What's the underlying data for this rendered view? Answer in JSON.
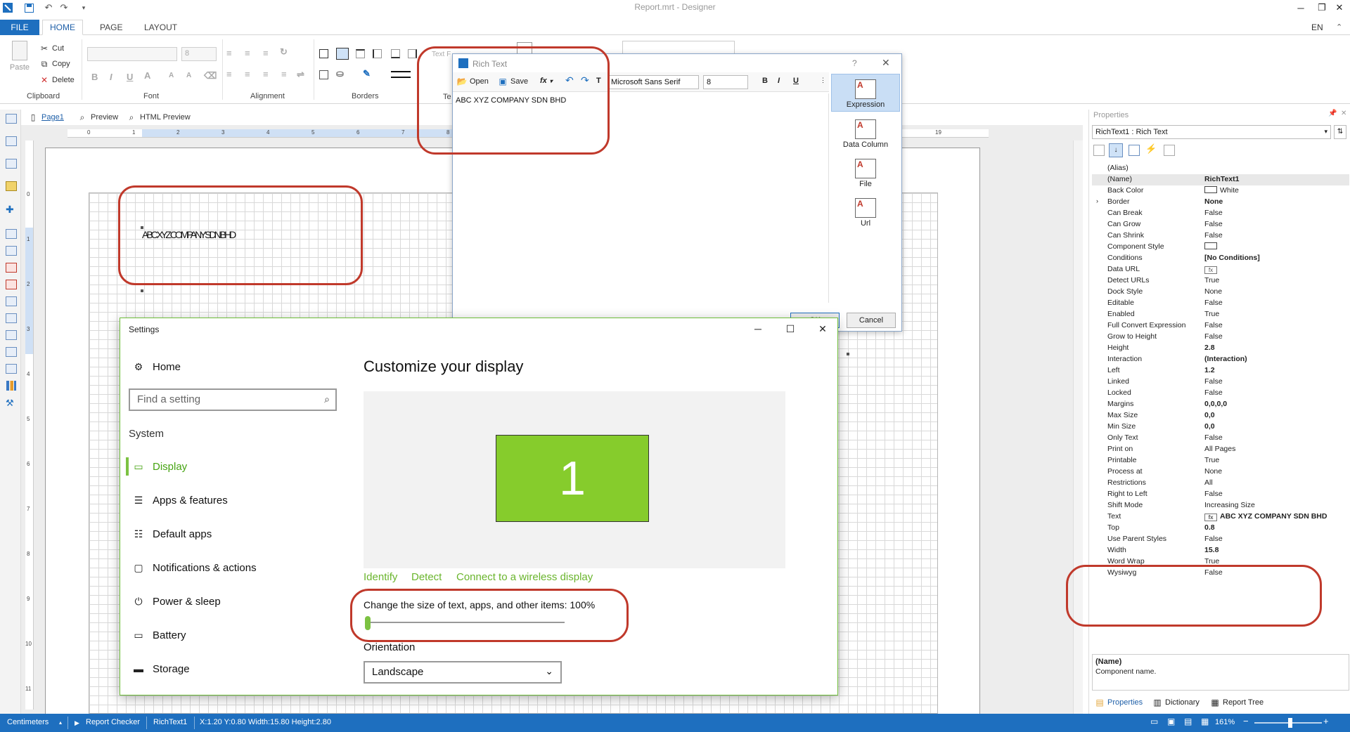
{
  "window": {
    "title": "Report.mrt - Designer",
    "lang": "EN"
  },
  "ribbon_tabs": [
    "FILE",
    "HOME",
    "PAGE",
    "LAYOUT"
  ],
  "ribbon": {
    "clipboard": {
      "paste": "Paste",
      "cut": "Cut",
      "copy": "Copy",
      "delete": "Delete",
      "label": "Clipboard"
    },
    "font": {
      "size": "8",
      "label": "Font"
    },
    "alignment_label": "Alignment",
    "borders_label": "Borders",
    "text_format_partial": "Text F",
    "text_partial": "Te"
  },
  "pagebar": {
    "page": "Page1",
    "preview": "Preview",
    "html_preview": "HTML Preview"
  },
  "ruler_h": [
    "0",
    "1",
    "2",
    "3",
    "4",
    "5",
    "6",
    "7",
    "8",
    "19"
  ],
  "ruler_v": [
    "0",
    "1",
    "2",
    "3",
    "4",
    "5",
    "6",
    "7",
    "8",
    "9",
    "10",
    "11"
  ],
  "design": {
    "component_text": "ABC XYZ COMPANY SDN BHD"
  },
  "rich_text_dialog": {
    "title": "Rich Text",
    "help": "?",
    "open": "Open",
    "save": "Save",
    "fx": "fx",
    "font": "Microsoft Sans Serif",
    "size": "8",
    "bold": "B",
    "italic": "I",
    "underline": "U",
    "content": "ABC XYZ COMPANY SDN BHD",
    "side": [
      "Expression",
      "Data Column",
      "File",
      "Url"
    ],
    "ok": "OK",
    "cancel": "Cancel"
  },
  "settings": {
    "title": "Settings",
    "home": "Home",
    "search_placeholder": "Find a setting",
    "section": "System",
    "nav": [
      "Display",
      "Apps & features",
      "Default apps",
      "Notifications & actions",
      "Power & sleep",
      "Battery",
      "Storage"
    ],
    "heading": "Customize your display",
    "monitor_number": "1",
    "links": [
      "Identify",
      "Detect",
      "Connect to a wireless display"
    ],
    "scale_label": "Change the size of text, apps, and other items: 100%",
    "scale_value": 0.0,
    "orientation_label": "Orientation",
    "orientation_value": "Landscape"
  },
  "properties": {
    "title": "Properties",
    "selected": "RichText1 : Rich Text",
    "rows": [
      {
        "k": "(Alias)",
        "v": ""
      },
      {
        "k": "(Name)",
        "v": "RichText1",
        "b": true
      },
      {
        "k": "Back Color",
        "v": "White",
        "swatch": true
      },
      {
        "k": "Border",
        "v": "None",
        "b": true
      },
      {
        "k": "Can Break",
        "v": "False"
      },
      {
        "k": "Can Grow",
        "v": "False"
      },
      {
        "k": "Can Shrink",
        "v": "False"
      },
      {
        "k": "Component Style",
        "v": "",
        "swatch": true
      },
      {
        "k": "Conditions",
        "v": "[No Conditions]",
        "b": true
      },
      {
        "k": "Data URL",
        "v": "",
        "fx": true
      },
      {
        "k": "Detect URLs",
        "v": "True"
      },
      {
        "k": "Dock Style",
        "v": "None"
      },
      {
        "k": "Editable",
        "v": "False"
      },
      {
        "k": "Enabled",
        "v": "True"
      },
      {
        "k": "Full Convert Expression",
        "v": "False"
      },
      {
        "k": "Grow to Height",
        "v": "False"
      },
      {
        "k": "Height",
        "v": "2.8",
        "b": true
      },
      {
        "k": "Interaction",
        "v": "(Interaction)",
        "b": true
      },
      {
        "k": "Left",
        "v": "1.2",
        "b": true
      },
      {
        "k": "Linked",
        "v": "False"
      },
      {
        "k": "Locked",
        "v": "False"
      },
      {
        "k": "Margins",
        "v": "0,0,0,0",
        "b": true
      },
      {
        "k": "Max Size",
        "v": "0,0",
        "b": true
      },
      {
        "k": "Min Size",
        "v": "0,0",
        "b": true
      },
      {
        "k": "Only Text",
        "v": "False"
      },
      {
        "k": "Print on",
        "v": "All Pages"
      },
      {
        "k": "Printable",
        "v": "True"
      },
      {
        "k": "Process at",
        "v": "None"
      },
      {
        "k": "Restrictions",
        "v": "All"
      },
      {
        "k": "Right to Left",
        "v": "False"
      },
      {
        "k": "Shift Mode",
        "v": "Increasing Size"
      },
      {
        "k": "Text",
        "v": "ABC XYZ COMPANY SDN BHD",
        "b": true,
        "fx": true
      },
      {
        "k": "Top",
        "v": "0.8",
        "b": true
      },
      {
        "k": "Use Parent Styles",
        "v": "False"
      },
      {
        "k": "Width",
        "v": "15.8",
        "b": true
      },
      {
        "k": "Word Wrap",
        "v": "True"
      },
      {
        "k": "Wysiwyg",
        "v": "False"
      }
    ],
    "desc_title": "(Name)",
    "desc_text": "Component name.",
    "tabs": [
      "Properties",
      "Dictionary",
      "Report Tree"
    ]
  },
  "status": {
    "units": "Centimeters",
    "checker": "Report Checker",
    "component": "RichText1",
    "coords": "X:1.20  Y:0.80  Width:15.80  Height:2.80",
    "zoom": "161%"
  }
}
